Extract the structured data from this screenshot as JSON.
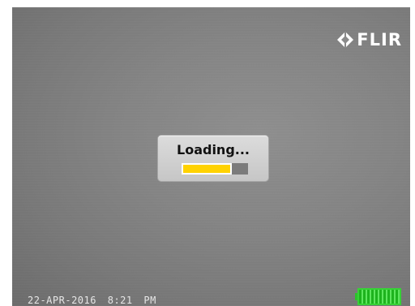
{
  "brand": {
    "logo_text": "FLIR",
    "logo_icon": "flir-diamond-icon",
    "logo_color": "#ffffff"
  },
  "loading_dialog": {
    "label": "Loading...",
    "progress": 0.75,
    "progress_color": "#ffd200"
  },
  "status_bar": {
    "date": "22-APR-2016",
    "time": "8:21 PM",
    "battery_icon": "battery-full-icon",
    "battery_color": "#2bc22b"
  }
}
